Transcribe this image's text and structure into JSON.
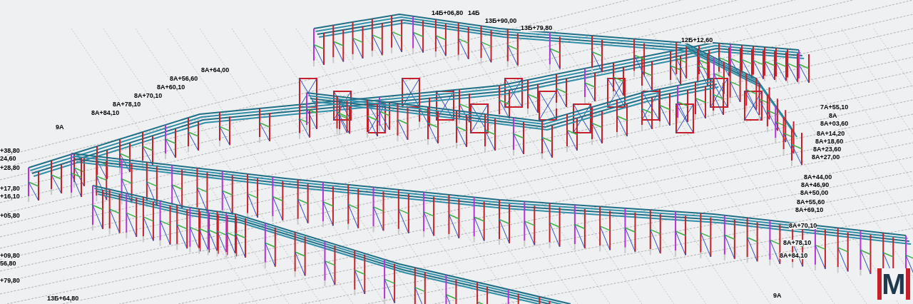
{
  "drawing": {
    "labels": [
      {
        "text": "8A+64,00"
      },
      {
        "text": "8A+56,60"
      },
      {
        "text": "8A+60,10"
      },
      {
        "text": "8A+70,10"
      },
      {
        "text": "8A+78,10"
      },
      {
        "text": "8A+84,10"
      },
      {
        "text": "9A"
      },
      {
        "text": "+38,80"
      },
      {
        "text": "24,60"
      },
      {
        "text": "+28,80"
      },
      {
        "text": "+17,80"
      },
      {
        "text": "+16,10"
      },
      {
        "text": "+05,80"
      },
      {
        "text": "+09,80"
      },
      {
        "text": "56,80"
      },
      {
        "text": "+79,80"
      },
      {
        "text": "13Б+64,80"
      },
      {
        "text": "14Б+06,80"
      },
      {
        "text": "14Б"
      },
      {
        "text": "13Б+90,00"
      },
      {
        "text": "13Б+79,80"
      },
      {
        "text": "12Б+12,60"
      },
      {
        "text": "7A+55,10"
      },
      {
        "text": "8A"
      },
      {
        "text": "8A+03,60"
      },
      {
        "text": "8A+14,20"
      },
      {
        "text": "8A+18,60"
      },
      {
        "text": "8A+23,60"
      },
      {
        "text": "8A+27,00"
      },
      {
        "text": "8A+44,00"
      },
      {
        "text": "8A+46,90"
      },
      {
        "text": "8A+50,00"
      },
      {
        "text": "8A+55,60"
      },
      {
        "text": "8A+69,10"
      },
      {
        "text": "8A+70,10"
      },
      {
        "text": "8A+78,10"
      },
      {
        "text": "8A+84,10"
      },
      {
        "text": "9A"
      }
    ]
  },
  "logo": {
    "text": "M"
  }
}
